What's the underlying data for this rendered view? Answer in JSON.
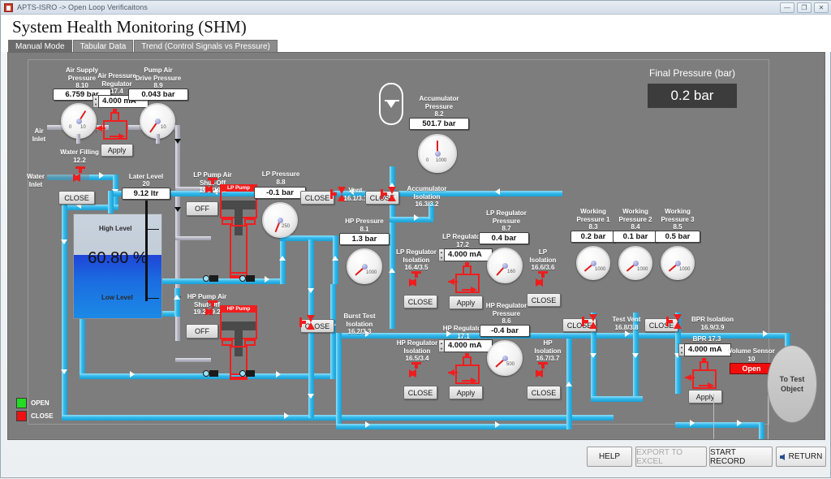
{
  "window": {
    "title": "APTS-ISRO -> Open Loop Verificaitons",
    "buttons": {
      "minimize": "—",
      "maximize": "❐",
      "close": "✕"
    }
  },
  "header": {
    "title": "System Health Monitoring (SHM)"
  },
  "tabs": [
    {
      "label": "Manual Mode",
      "active": true
    },
    {
      "label": "Tabular Data",
      "active": false
    },
    {
      "label": "Trend (Control Signals vs Pressure)",
      "active": false
    }
  ],
  "final_pressure": {
    "title": "Final Pressure (bar)",
    "value": "0.2 bar"
  },
  "inlets": {
    "air": "Air\nInlet",
    "water": "Water\nInlet"
  },
  "tank": {
    "percent": "60.80 %",
    "high_label": "High Level",
    "low_label": "Low Level",
    "level_name": "Later Level",
    "level_tag": "20",
    "level_value": "9.12 ltr",
    "fill_percent": 60.8
  },
  "gauges": [
    {
      "name": "air-supply-pressure",
      "label": "Air Supply\nPressure",
      "tag": "8.10",
      "value": "6.759 bar",
      "scale_min": "0",
      "scale_max": "10"
    },
    {
      "name": "pump-air-drive-pressure",
      "label": "Pump Air\nDrive Pressure",
      "tag": "8.9",
      "value": "0.043 bar",
      "scale_min": "0",
      "scale_max": "10"
    },
    {
      "name": "accumulator-pressure",
      "label": "Accumulator\nPressure",
      "tag": "8.2",
      "value": "501.7 bar",
      "scale_min": "0",
      "scale_max": "1000"
    },
    {
      "name": "lp-pressure",
      "label": "LP Pressure",
      "tag": "8.8",
      "value": "-0.1 bar",
      "scale_min": "0",
      "scale_max": "250"
    },
    {
      "name": "hp-pressure",
      "label": "HP Pressure",
      "tag": "8.1",
      "value": "1.3 bar",
      "scale_min": "0",
      "scale_max": "1000"
    },
    {
      "name": "lp-regulator-pressure",
      "label": "LP Regulator\nPressure",
      "tag": "8.7",
      "value": "0.4 bar",
      "scale_min": "0",
      "scale_max": "160"
    },
    {
      "name": "hp-regulator-pressure",
      "label": "HP Regulator\nPressure",
      "tag": "8.6",
      "value": "-0.4 bar",
      "scale_min": "0",
      "scale_max": "500"
    },
    {
      "name": "working-pressure-1",
      "label": "Working\nPressure 1",
      "tag": "8.3",
      "value": "0.2 bar",
      "scale_min": "0",
      "scale_max": "1000"
    },
    {
      "name": "working-pressure-2",
      "label": "Working\nPressure 2",
      "tag": "8.4",
      "value": "0.1 bar",
      "scale_min": "0",
      "scale_max": "1000"
    },
    {
      "name": "working-pressure-3",
      "label": "Working\nPressure 3",
      "tag": "8.5",
      "value": "0.5 bar",
      "scale_min": "0",
      "scale_max": "1000"
    }
  ],
  "regulators": [
    {
      "name": "air-pressure-regulator",
      "label": "Air Pressure\nRegulator",
      "tag": "17.4",
      "value": "4.000 mA",
      "apply": "Apply"
    },
    {
      "name": "lp-regulator",
      "label": "LP Regulator",
      "tag": "17.2",
      "value": "4.000 mA",
      "apply": "Apply"
    },
    {
      "name": "hp-regulator",
      "label": "HP Regulator",
      "tag": "17.1",
      "value": "4.000 mA",
      "apply": "Apply"
    },
    {
      "name": "bpr",
      "label": "BPR 17.3",
      "tag": "",
      "value": "4.000 mA",
      "apply": "Apply"
    }
  ],
  "valves": [
    {
      "name": "water-filling",
      "label": "Water Filling",
      "tag": "12.2",
      "button": "CLOSE"
    },
    {
      "name": "lp-pump-air-shutoff",
      "label": "LP Pump Air\nShut-Off",
      "tag": "19.1/19.1",
      "button": "OFF"
    },
    {
      "name": "hp-pump-air-shutoff",
      "label": "HP Pump Air\nShut-Off",
      "tag": "19.2/19.2",
      "button": "OFF"
    },
    {
      "name": "vent",
      "label": "Vent",
      "tag": "16.1/3.1",
      "button": "CLOSE"
    },
    {
      "name": "accumulator-isolation",
      "label": "Accumulator\nIsolation",
      "tag": "16.3/3.2",
      "button": "CLOSE"
    },
    {
      "name": "burst-test-isolation",
      "label": "Burst Test\nIsolation",
      "tag": "16.2/3.3",
      "button": "CLOSE"
    },
    {
      "name": "lp-regulator-isolation",
      "label": "LP Regulator\nIsolation",
      "tag": "16.4/3.5",
      "button": "CLOSE"
    },
    {
      "name": "hp-regulator-isolation",
      "label": "HP Regulator\nIsolation",
      "tag": "16.5/3.4",
      "button": "CLOSE"
    },
    {
      "name": "lp-isolation",
      "label": "LP\nIsolation",
      "tag": "16.6/3.6",
      "button": "CLOSE"
    },
    {
      "name": "hp-isolation",
      "label": "HP\nIsolation",
      "tag": "16.7/3.7",
      "button": "CLOSE"
    },
    {
      "name": "test-vent",
      "label": "Test Vent",
      "tag": "16.8/3.8",
      "button": "CLOSE"
    },
    {
      "name": "bpr-isolation",
      "label": "BPR Isolation",
      "tag": "16.9/3.9",
      "button": "CLOSE"
    }
  ],
  "pumps": [
    {
      "name": "lp-pump",
      "label": "LP Pump"
    },
    {
      "name": "hp-pump",
      "label": "HP Pump"
    }
  ],
  "volume_sensor": {
    "label": "Volume Sensor",
    "tag": "10",
    "state": "Open"
  },
  "test_object": {
    "label": "To Test\nObject"
  },
  "legend": [
    {
      "label": "OPEN",
      "color": "#22dd22"
    },
    {
      "label": "CLOSE",
      "color": "#ee1111"
    }
  ],
  "footer": [
    {
      "name": "help-button",
      "label": "HELP",
      "disabled": false
    },
    {
      "name": "export-to-excel-button",
      "label": "EXPORT TO EXCEL",
      "disabled": true
    },
    {
      "name": "start-record-button",
      "label": "START RECORD",
      "disabled": false
    },
    {
      "name": "return-button",
      "label": "RETURN",
      "disabled": false
    }
  ],
  "colors": {
    "pipe_water": "#34b8ea",
    "pipe_air": "#b9b9c6",
    "valve_red": "#ef1c1c",
    "canvas_bg": "#7d7d7d",
    "open": "#22dd22",
    "close": "#ee1111"
  }
}
